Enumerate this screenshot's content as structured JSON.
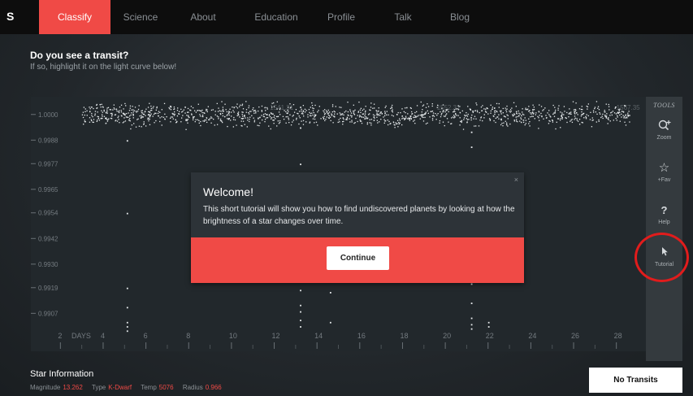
{
  "nav": {
    "logo": "S",
    "items": [
      "Classify",
      "Science",
      "About",
      "Education",
      "Profile",
      "Talk",
      "Blog"
    ],
    "active_index": 0
  },
  "question": {
    "title": "Do you see a transit?",
    "subtitle": "If so, highlight it on the light curve below!"
  },
  "chart_data": {
    "type": "scatter",
    "xlabel": "DAYS",
    "x_ticks": [
      2,
      4,
      6,
      8,
      10,
      12,
      14,
      16,
      18,
      20,
      22,
      24,
      26,
      28
    ],
    "y_ticks": [
      "1.0000",
      "0.9988",
      "0.9977",
      "0.9965",
      "0.9954",
      "0.9942",
      "0.9930",
      "0.9919",
      "0.9907"
    ],
    "top_axis_labels": [
      "1541.31",
      "1552.31",
      "1567.35"
    ],
    "xlim": [
      1,
      29
    ],
    "ylim": [
      0.9898,
      1.0006
    ]
  },
  "tools": {
    "title": "TOOLS",
    "items": [
      {
        "icon": "zoom-icon",
        "label": "Zoom"
      },
      {
        "icon": "star-icon",
        "label": "+Fav"
      },
      {
        "icon": "help-icon",
        "label": "Help"
      },
      {
        "icon": "pointer-icon",
        "label": "Tutorial"
      }
    ]
  },
  "modal": {
    "title": "Welcome!",
    "body": "This short tutorial will show you how to find undiscovered planets by looking at how the brightness of a star changes over time.",
    "button": "Continue",
    "close": "×"
  },
  "star_info": {
    "title": "Star Information",
    "fields": [
      {
        "label": "Magnitude",
        "value": "13.262"
      },
      {
        "label": "Type",
        "value": "K-Dwarf"
      },
      {
        "label": "Temp",
        "value": "5076"
      },
      {
        "label": "Radius",
        "value": "0.966"
      }
    ]
  },
  "actions": {
    "no_transits": "No Transits"
  },
  "colors": {
    "accent": "#f04a46",
    "highlight_ring": "#e11c1c"
  }
}
